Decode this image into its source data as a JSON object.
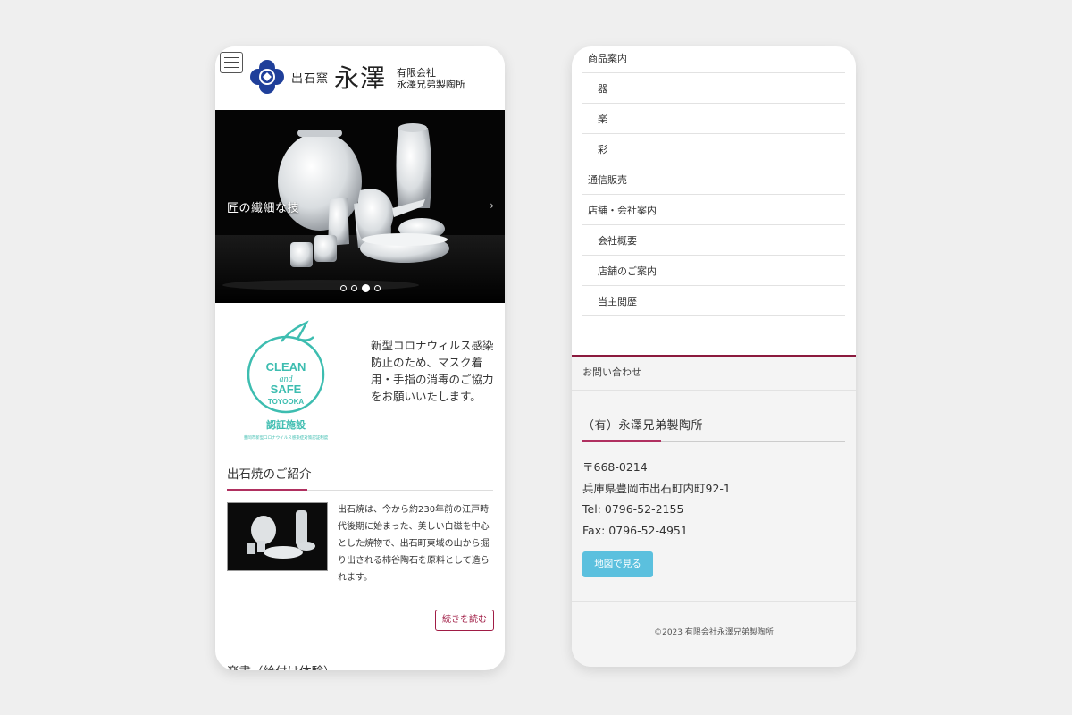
{
  "left_phone": {
    "header": {
      "logo_sub": "出石窯",
      "logo_main": "永澤",
      "company_line1": "有限会社",
      "company_line2": "永澤兄弟製陶所"
    },
    "hero": {
      "caption": "匠の繊細な技",
      "next_icon": "›",
      "slide_count": 4,
      "active_slide": 3
    },
    "clean_badge": {
      "line1": "CLEAN",
      "line2": "and",
      "line3": "SAFE",
      "line4": "TOYOOKA",
      "cert": "認証施設",
      "fine_print": "豊岡市新型コロナウイルス感染症対策認証制度",
      "color": "#3dbdb0"
    },
    "notice": "新型コロナウィルス感染防止のため、マスク着用・手指の消毒のご協力をお願いいたします。",
    "intro": {
      "title": "出石焼のご紹介",
      "text": "出石焼は、今から約230年前の江戸時代後期に始まった、美しい白磁を中心とした焼物で、出石町東域の山から掘り出される柿谷陶石を原料として造られます。",
      "more_button": "続きを読む"
    },
    "next_section_title": "楽書（絵付け体験）"
  },
  "right_phone": {
    "menu": [
      {
        "label": "商品案内",
        "sub": false
      },
      {
        "label": "器",
        "sub": true
      },
      {
        "label": "楽",
        "sub": true
      },
      {
        "label": "彩",
        "sub": true
      },
      {
        "label": "通信販売",
        "sub": false
      },
      {
        "label": "店舗・会社案内",
        "sub": false
      },
      {
        "label": "会社概要",
        "sub": true
      },
      {
        "label": "店舗のご案内",
        "sub": true
      },
      {
        "label": "当主閲歴",
        "sub": true
      }
    ],
    "contact_heading": "お問い合わせ",
    "company_name": "（有）永澤兄弟製陶所",
    "postal": "〒668-0214",
    "address": "兵庫県豊岡市出石町内町92-1",
    "tel": "Tel: 0796-52-2155",
    "fax": "Fax: 0796-52-4951",
    "map_button": "地図で見る",
    "copyright": "©2023 有限会社永澤兄弟製陶所"
  },
  "colors": {
    "accent": "#b03060",
    "footer_bar": "#8b1a3e",
    "map_button": "#5bc0de",
    "badge_teal": "#3dbdb0"
  }
}
